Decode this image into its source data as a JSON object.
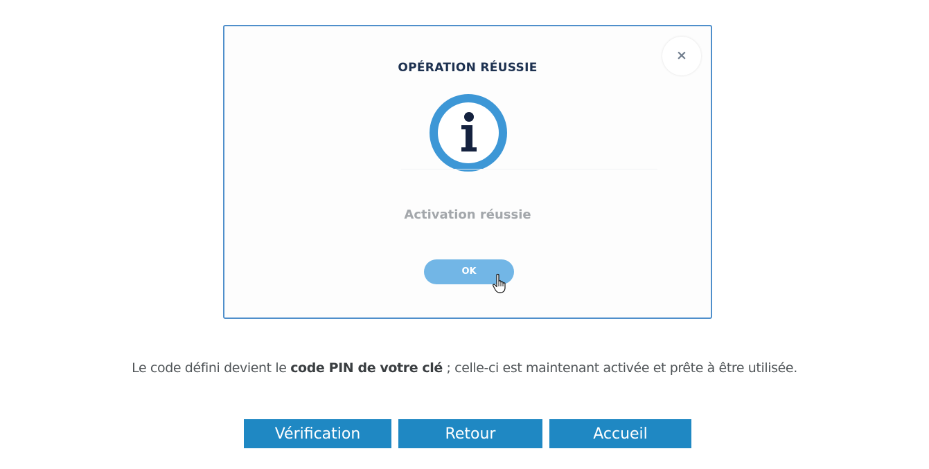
{
  "dialog": {
    "title": "OPÉRATION RÉUSSIE",
    "close_label": "×",
    "icon": "info-icon",
    "message": "Activation réussie",
    "ok_label": "OK"
  },
  "description": {
    "before": "Le code défini devient le ",
    "bold": "code PIN de votre clé",
    "after": " ; celle-ci est maintenant activée et prête à être utilisée."
  },
  "buttons": {
    "verification": "Vérification",
    "retour": "Retour",
    "accueil": "Accueil"
  },
  "colors": {
    "frame_border": "#4f8fcb",
    "info_ring": "#3d97d6",
    "ok_button": "#72b6e6",
    "nav_button": "#1f88c3"
  }
}
